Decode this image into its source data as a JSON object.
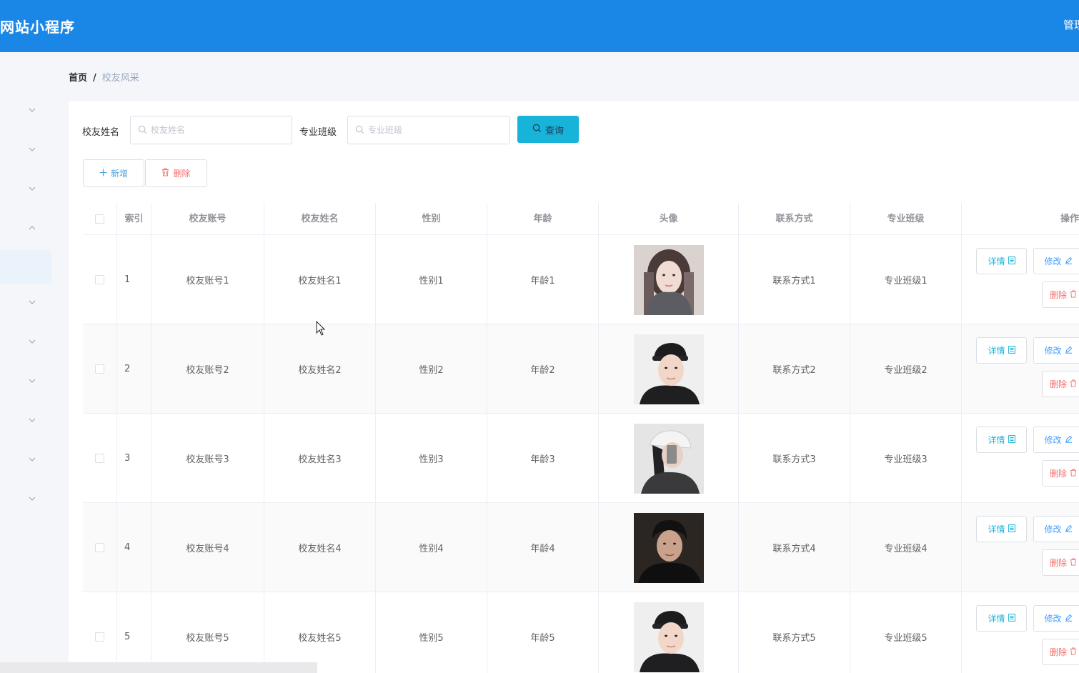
{
  "header": {
    "title": "网站小程序",
    "user": "管理员"
  },
  "breadcrumb": {
    "home": "首页",
    "separator": "/",
    "current": "校友风采"
  },
  "search": {
    "name_label": "校友姓名",
    "name_placeholder": "校友姓名",
    "class_label": "专业班级",
    "class_placeholder": "专业班级",
    "search_button": "查询"
  },
  "toolbar": {
    "add_label": "新增",
    "delete_label": "删除"
  },
  "table": {
    "columns": {
      "index": "索引",
      "account": "校友账号",
      "name": "校友姓名",
      "gender": "性别",
      "age": "年龄",
      "avatar": "头像",
      "contact": "联系方式",
      "class": "专业班级",
      "actions": "操作"
    },
    "actions": {
      "detail": "详情",
      "edit": "修改",
      "delete": "删除"
    },
    "rows": [
      {
        "index": "1",
        "account": "校友账号1",
        "name": "校友姓名1",
        "gender": "性别1",
        "age": "年龄1",
        "contact": "联系方式1",
        "class": "专业班级1",
        "avatar": "woman-scarf"
      },
      {
        "index": "2",
        "account": "校友账号2",
        "name": "校友姓名2",
        "gender": "性别2",
        "age": "年龄2",
        "contact": "联系方式2",
        "class": "专业班级2",
        "avatar": "man-cap"
      },
      {
        "index": "3",
        "account": "校友账号3",
        "name": "校友姓名3",
        "gender": "性别3",
        "age": "年龄3",
        "contact": "联系方式3",
        "class": "专业班级3",
        "avatar": "selfie-cap"
      },
      {
        "index": "4",
        "account": "校友账号4",
        "name": "校友姓名4",
        "gender": "性别4",
        "age": "年龄4",
        "contact": "联系方式4",
        "class": "专业班级4",
        "avatar": "man-dark"
      },
      {
        "index": "5",
        "account": "校友账号5",
        "name": "校友姓名5",
        "gender": "性别5",
        "age": "年龄5",
        "contact": "联系方式5",
        "class": "专业班级5",
        "avatar": "man-cap"
      }
    ]
  },
  "colors": {
    "header": "#1a86e6",
    "search_button": "#17b3d9",
    "danger": "#f56c6c",
    "primary": "#409eff"
  }
}
